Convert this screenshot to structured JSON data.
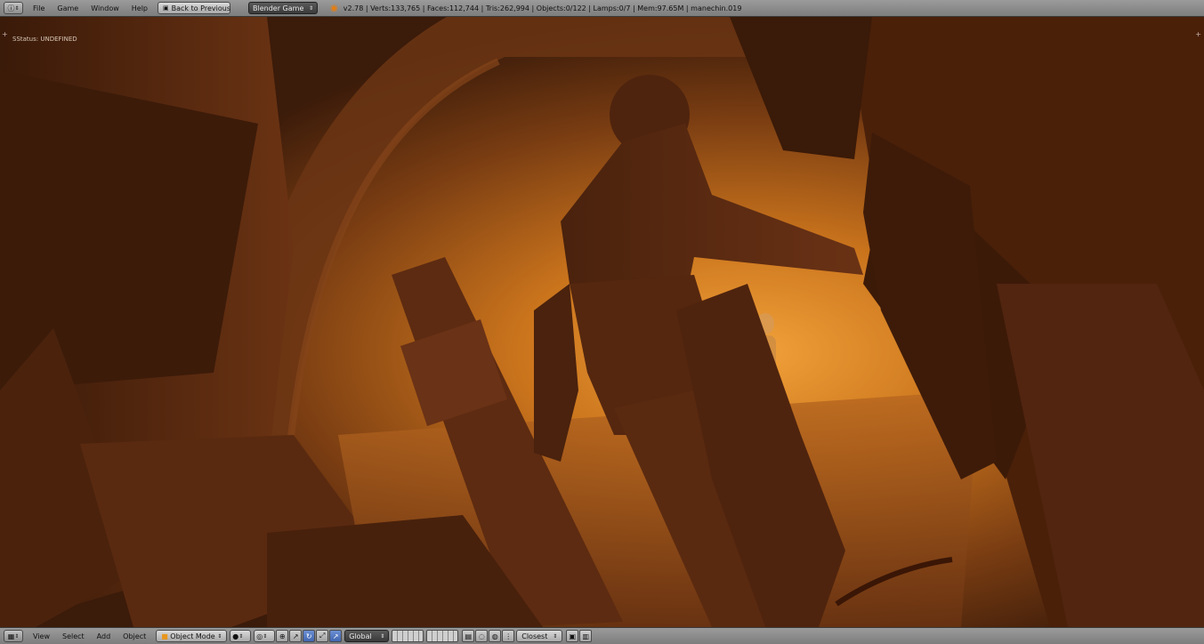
{
  "top_menu": {
    "items": [
      "File",
      "Game",
      "Window",
      "Help"
    ],
    "back_button": "Back to Previous",
    "engine": "Blender Game",
    "stats": "v2.78 | Verts:133,765 | Faces:112,744 | Tris:262,994 | Objects:0/122 | Lamps:0/7 | Mem:97.65M | manechin.019"
  },
  "viewport": {
    "status": "SStatus: UNDEFINED",
    "corner_symbol": "+"
  },
  "bottom_menu": {
    "items": [
      "View",
      "Select",
      "Add",
      "Object"
    ],
    "mode": "Object Mode",
    "orientation": "Global",
    "snap": "Closest"
  },
  "icons": {
    "editor_type": "info-icon",
    "engine_logo": "blender-logo-icon",
    "view3d": "view3d-icon"
  }
}
